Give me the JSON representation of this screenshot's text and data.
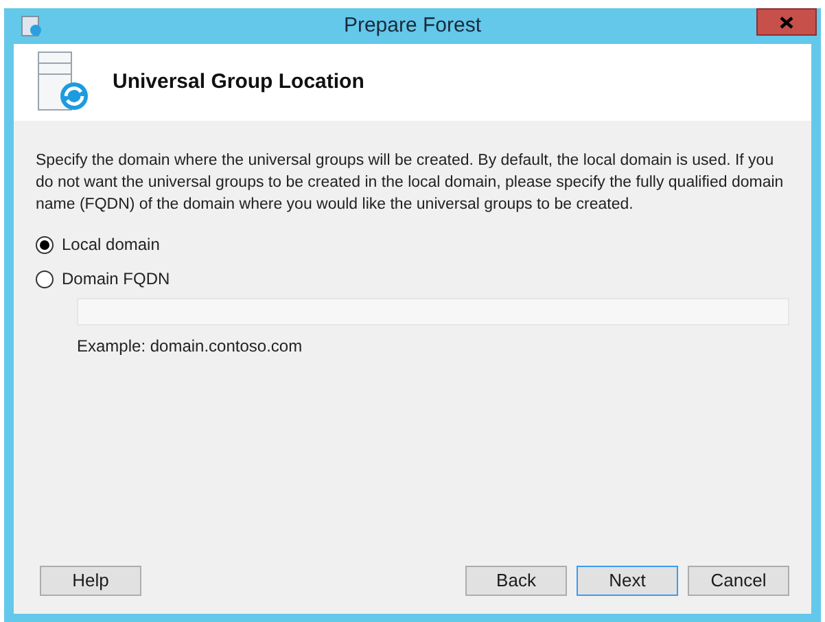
{
  "window": {
    "title": "Prepare Forest"
  },
  "header": {
    "title": "Universal Group Location"
  },
  "description": "Specify the domain where the universal groups will be created. By default, the local domain is used. If you do not want the universal groups to be created in the local domain, please specify the fully qualified domain name (FQDN) of the domain where you would like the universal groups to be created.",
  "options": [
    {
      "label": "Local domain",
      "selected": true
    },
    {
      "label": "Domain FQDN",
      "selected": false
    }
  ],
  "fqdn_field": {
    "disabled": true
  },
  "example": "Example: domain.contoso.com",
  "buttons": [
    {
      "label": "Help",
      "kind": "left",
      "default": false
    },
    {
      "label": "Back",
      "kind": "right",
      "default": false
    },
    {
      "label": "Next",
      "kind": "right",
      "default": true
    },
    {
      "label": "Cancel",
      "kind": "right",
      "default": false
    }
  ]
}
